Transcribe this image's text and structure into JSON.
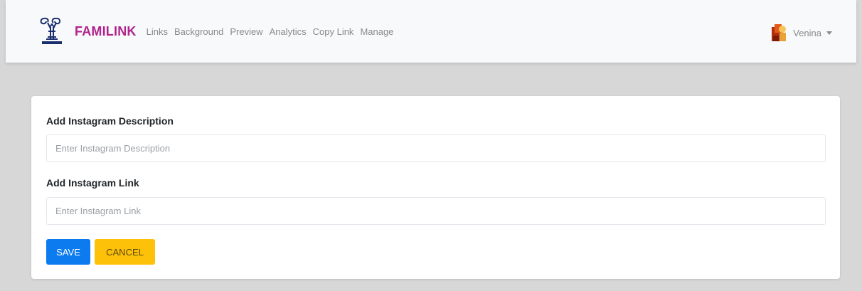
{
  "navbar": {
    "brand_name": "FAMILINK",
    "brand_color": "#b0228c",
    "logo_icon": "familink-logo-icon",
    "links": [
      {
        "label": "Links"
      },
      {
        "label": "Background"
      },
      {
        "label": "Preview"
      },
      {
        "label": "Analytics"
      },
      {
        "label": "Copy Link"
      },
      {
        "label": "Manage"
      }
    ],
    "user": {
      "name": "Venina",
      "avatar_icon": "user-avatar-icon",
      "dropdown_icon": "caret-down-icon"
    }
  },
  "form": {
    "description": {
      "label": "Add Instagram Description",
      "placeholder": "Enter Instagram Description",
      "value": ""
    },
    "link": {
      "label": "Add Instagram Link",
      "placeholder": "Enter Instagram Link",
      "value": ""
    },
    "save_label": "SAVE",
    "cancel_label": "CANCEL"
  },
  "colors": {
    "save_button": "#0d7bf0",
    "cancel_button": "#fec10a",
    "page_background": "#d7d7d7"
  }
}
